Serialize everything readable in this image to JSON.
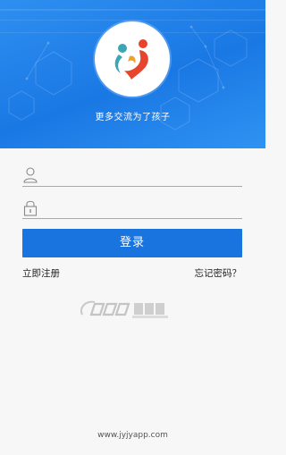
{
  "header": {
    "slogan": "更多交流为了孩子",
    "logo_colors": {
      "teal": "#3aa7b5",
      "red": "#e8432c",
      "orange": "#f0a12a"
    },
    "background_color": "#1a78e4"
  },
  "login_form": {
    "username_icon": "user-icon",
    "password_icon": "lock-icon",
    "username_value": "",
    "password_value": "",
    "login_button_label": "登录",
    "button_color": "#1a74e0"
  },
  "links": {
    "register_label": "立即注册",
    "forgot_password_label": "忘记密码？"
  },
  "watermark": {
    "text": "jiuluwang"
  },
  "footer": {
    "url": "www.jyjyapp.com"
  }
}
